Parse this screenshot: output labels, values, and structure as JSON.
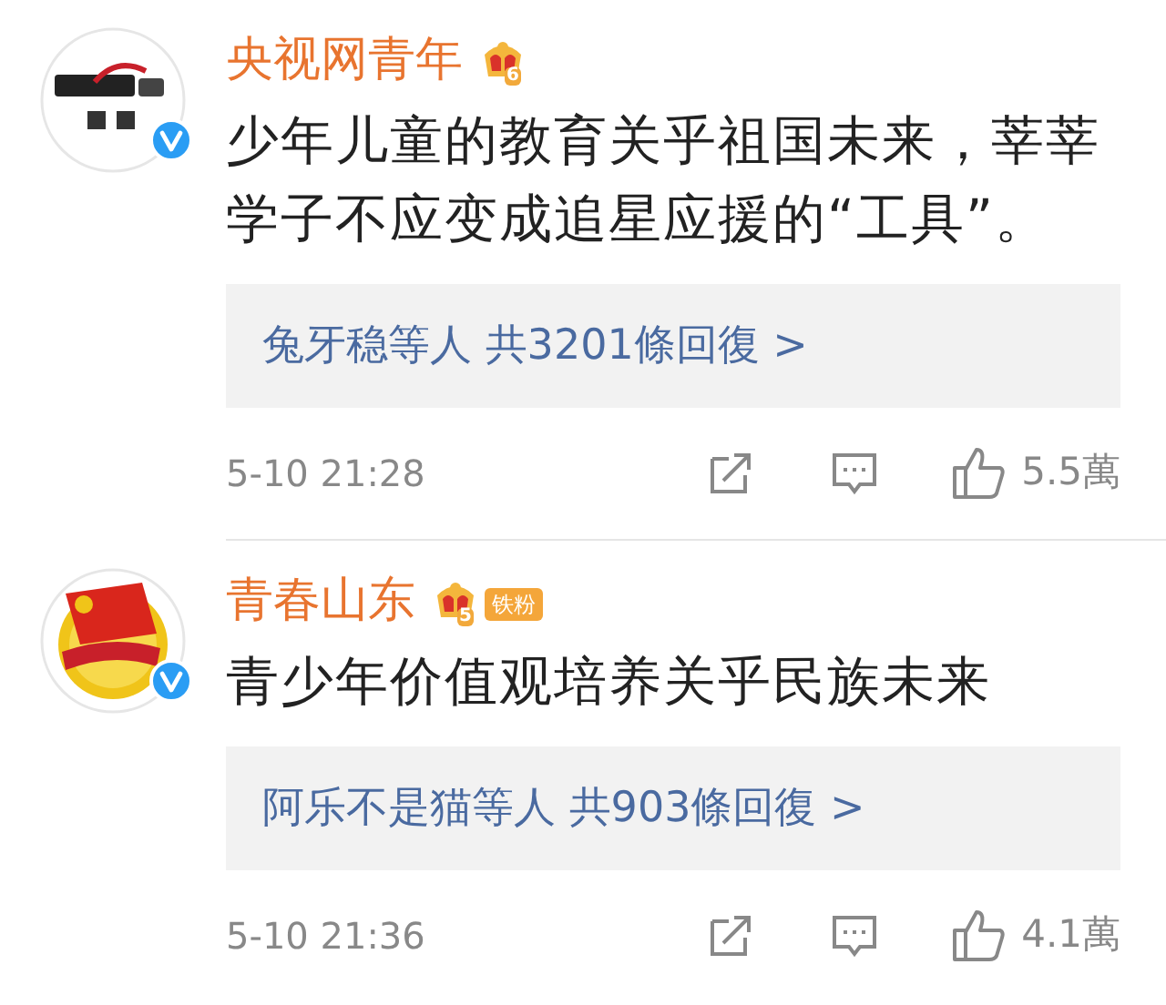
{
  "comments": [
    {
      "avatar": {
        "kind": "cctv",
        "verified": true
      },
      "name": "央视网青年",
      "badge": {
        "level": "6"
      },
      "text": "少年儿童的教育关乎祖国未来，莘莘学子不应变成追星应援的“工具”。",
      "replies": "兔牙稳等人 共3201條回復 >",
      "time": "5-10 21:28",
      "likes": "5.5萬"
    },
    {
      "avatar": {
        "kind": "emblem",
        "verified": true
      },
      "name": "青春山东",
      "badge": {
        "level": "5",
        "label": "铁粉"
      },
      "text": "青少年价值观培养关乎民族未来",
      "replies": "阿乐不是猫等人 共903條回復 >",
      "time": "5-10 21:36",
      "likes": "4.1萬"
    }
  ]
}
